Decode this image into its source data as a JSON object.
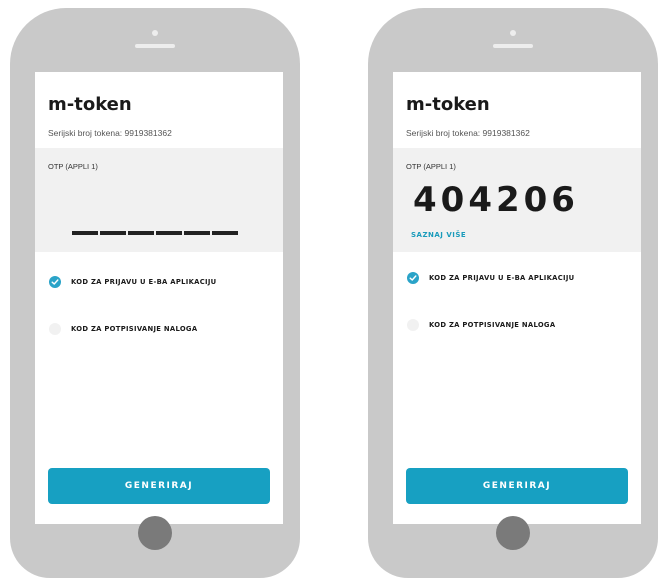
{
  "colors": {
    "accent": "#17a0c2",
    "phone_body": "#c9c9c9",
    "home_button": "#7a7a7a",
    "panel_bg": "#f1f1f1"
  },
  "phones": [
    {
      "app_title": "m-token",
      "serial_label": "Serijski broj tokena: 9919381362",
      "otp_label": "OTP (APPLI 1)",
      "otp_state": "hidden",
      "options": [
        {
          "label": "KOD ZA PRIJAVU U E-BA APLIKACIJU",
          "selected": true
        },
        {
          "label": "KOD ZA POTPISIVANJE NALOGA",
          "selected": false
        }
      ],
      "generate_label": "GENERIRAJ"
    },
    {
      "app_title": "m-token",
      "serial_label": "Serijski broj tokena: 9919381362",
      "otp_label": "OTP (APPLI 1)",
      "otp_code": "404206",
      "learn_more_label": "SAZNAJ VIŠE",
      "options": [
        {
          "label": "KOD ZA PRIJAVU U E-BA APLIKACIJU",
          "selected": true
        },
        {
          "label": "KOD ZA POTPISIVANJE NALOGA",
          "selected": false
        }
      ],
      "generate_label": "GENERIRAJ"
    }
  ]
}
